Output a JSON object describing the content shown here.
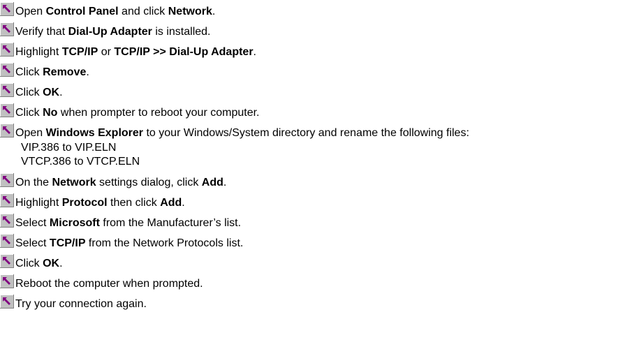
{
  "steps": [
    {
      "segments": [
        {
          "t": "Open ",
          "b": false
        },
        {
          "t": "Control Panel",
          "b": true
        },
        {
          "t": " and click ",
          "b": false
        },
        {
          "t": "Network",
          "b": true
        },
        {
          "t": ".",
          "b": false
        }
      ]
    },
    {
      "segments": [
        {
          "t": "Verify that ",
          "b": false
        },
        {
          "t": "Dial-Up Adapter",
          "b": true
        },
        {
          "t": " is installed.",
          "b": false
        }
      ]
    },
    {
      "segments": [
        {
          "t": "Highlight ",
          "b": false
        },
        {
          "t": "TCP/IP",
          "b": true
        },
        {
          "t": " or ",
          "b": false
        },
        {
          "t": "TCP/IP >> Dial-Up Adapter",
          "b": true
        },
        {
          "t": ".",
          "b": false
        }
      ]
    },
    {
      "segments": [
        {
          "t": "Click ",
          "b": false
        },
        {
          "t": "Remove",
          "b": true
        },
        {
          "t": ".",
          "b": false
        }
      ]
    },
    {
      "segments": [
        {
          "t": "Click ",
          "b": false
        },
        {
          "t": "OK",
          "b": true
        },
        {
          "t": ".",
          "b": false
        }
      ]
    },
    {
      "segments": [
        {
          "t": "Click ",
          "b": false
        },
        {
          "t": "No",
          "b": true
        },
        {
          "t": " when prompter to reboot your computer.",
          "b": false
        }
      ]
    },
    {
      "segments": [
        {
          "t": "Open ",
          "b": false
        },
        {
          "t": "Windows Explorer",
          "b": true
        },
        {
          "t": " to your Windows/System directory and rename the following files:",
          "b": false
        }
      ],
      "sublines": [
        "VIP.386 to VIP.ELN",
        "VTCP.386 to VTCP.ELN"
      ]
    },
    {
      "segments": [
        {
          "t": "On the ",
          "b": false
        },
        {
          "t": "Network",
          "b": true
        },
        {
          "t": " settings dialog, click ",
          "b": false
        },
        {
          "t": "Add",
          "b": true
        },
        {
          "t": ".",
          "b": false
        }
      ]
    },
    {
      "segments": [
        {
          "t": "Highlight ",
          "b": false
        },
        {
          "t": "Protocol",
          "b": true
        },
        {
          "t": " then click ",
          "b": false
        },
        {
          "t": "Add",
          "b": true
        },
        {
          "t": ".",
          "b": false
        }
      ]
    },
    {
      "segments": [
        {
          "t": "Select ",
          "b": false
        },
        {
          "t": "Microsoft",
          "b": true
        },
        {
          "t": " from the Manufacturer’s list.",
          "b": false
        }
      ]
    },
    {
      "segments": [
        {
          "t": "Select ",
          "b": false
        },
        {
          "t": "TCP/IP",
          "b": true
        },
        {
          "t": " from the Network Protocols list.",
          "b": false
        }
      ]
    },
    {
      "segments": [
        {
          "t": "Click ",
          "b": false
        },
        {
          "t": "OK",
          "b": true
        },
        {
          "t": ".",
          "b": false
        }
      ]
    },
    {
      "segments": [
        {
          "t": "Reboot the computer when prompted.",
          "b": false
        }
      ]
    },
    {
      "segments": [
        {
          "t": "Try your connection again.",
          "b": false
        }
      ]
    }
  ],
  "icon": {
    "name": "shortcut-jump-icon",
    "face_color": "#c0c0c0",
    "arrow_color": "#800080",
    "highlight_color": "#ffffff",
    "shadow_color": "#808080"
  }
}
